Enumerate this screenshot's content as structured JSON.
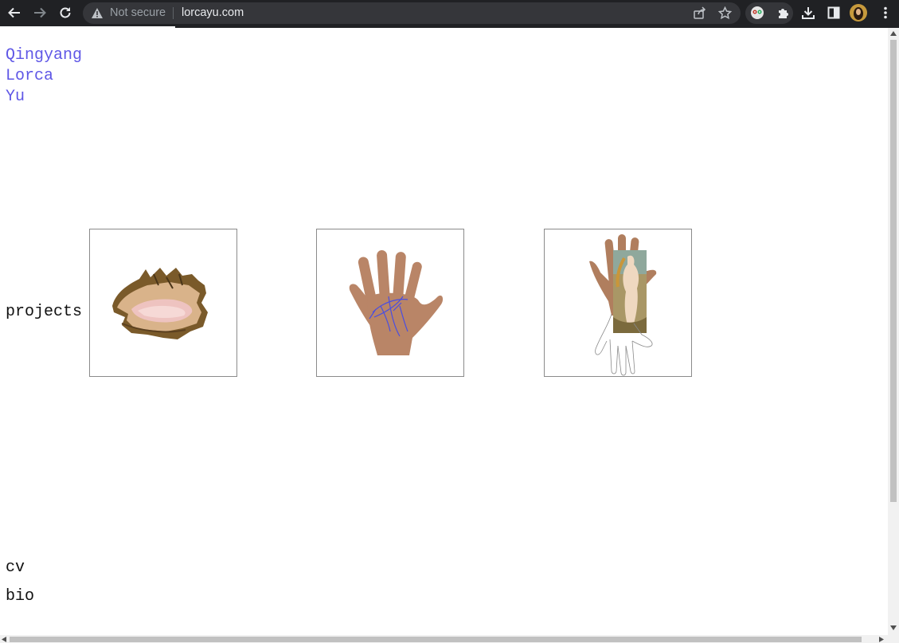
{
  "browser": {
    "security_label": "Not secure",
    "url": "lorcayu.com"
  },
  "site": {
    "name_lines": [
      "Qingyang",
      "Lorca",
      "Yu"
    ],
    "projects_label": "projects",
    "cv_label": "cv",
    "bio_label": "bio",
    "accent_color": "#5f57e6"
  },
  "projects": [
    {
      "image": "conch-shell"
    },
    {
      "image": "palm-hand-with-blue-lines"
    },
    {
      "image": "hand-with-venus-painting-collage"
    }
  ]
}
